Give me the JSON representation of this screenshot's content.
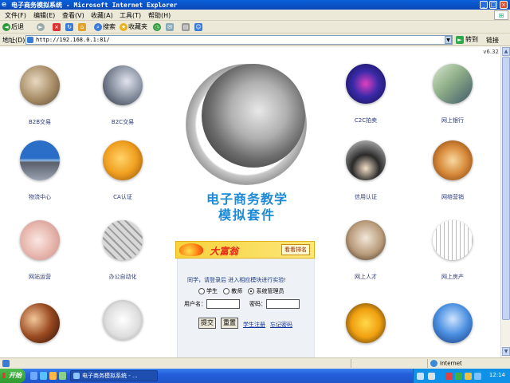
{
  "window": {
    "title": "电子商务模拟系统 - Microsoft Internet Explorer",
    "minimize_glyph": "_",
    "maximize_glyph": "□",
    "close_glyph": "×"
  },
  "menu": [
    "文件(F)",
    "编辑(E)",
    "查看(V)",
    "收藏(A)",
    "工具(T)",
    "帮助(H)"
  ],
  "toolbar": {
    "back": "后退",
    "forward_glyph": "►",
    "search": "搜索",
    "favorites": "收藏夹"
  },
  "address": {
    "label": "地址(D)",
    "url": "http://192.168.0.1:81/",
    "go": "转到",
    "links": "链接"
  },
  "page": {
    "version": "v6.32",
    "items_left": [
      {
        "label": "B2B交易",
        "icon": "handshake"
      },
      {
        "label": "B2C交易",
        "icon": "hand-writing"
      },
      {
        "label": "物流中心",
        "icon": "highway"
      },
      {
        "label": "CA认证",
        "icon": "key"
      },
      {
        "label": "网站运营",
        "icon": "hand"
      },
      {
        "label": "办公自动化",
        "icon": "keyboard"
      },
      {
        "label": "",
        "icon": "globe"
      },
      {
        "label": "",
        "icon": "microscope"
      }
    ],
    "items_right": [
      {
        "label": "C2C拍卖",
        "icon": "auction"
      },
      {
        "label": "网上银行",
        "icon": "banknote"
      },
      {
        "label": "信用认证",
        "icon": "graduates"
      },
      {
        "label": "网络营销",
        "icon": "abacus"
      },
      {
        "label": "网上人才",
        "icon": "glasses"
      },
      {
        "label": "网上房产",
        "icon": "building"
      },
      {
        "label": "",
        "icon": "puzzle"
      },
      {
        "label": "",
        "icon": "business-people"
      }
    ],
    "logo_title_line1": "电子商务教学",
    "logo_title_line2": "模拟套件",
    "banner": {
      "title": "大富翁",
      "rank_button": "看看排名"
    },
    "login": {
      "hint": "同学，请登录后 进入相应模块进行实验!",
      "roles": [
        "学生",
        "教师",
        "系统管理员"
      ],
      "selected_role": "系统管理员",
      "username_label": "用户名：",
      "password_label": "密码：",
      "username_value": "",
      "password_value": "",
      "submit": "提交",
      "reset": "重置",
      "register": "学生注册",
      "forgot": "忘记密码"
    }
  },
  "status": {
    "zone": "Internet"
  },
  "taskbar": {
    "start": "开始",
    "task_title": "电子商务模拟系统 - ...",
    "clock": "12:14"
  }
}
